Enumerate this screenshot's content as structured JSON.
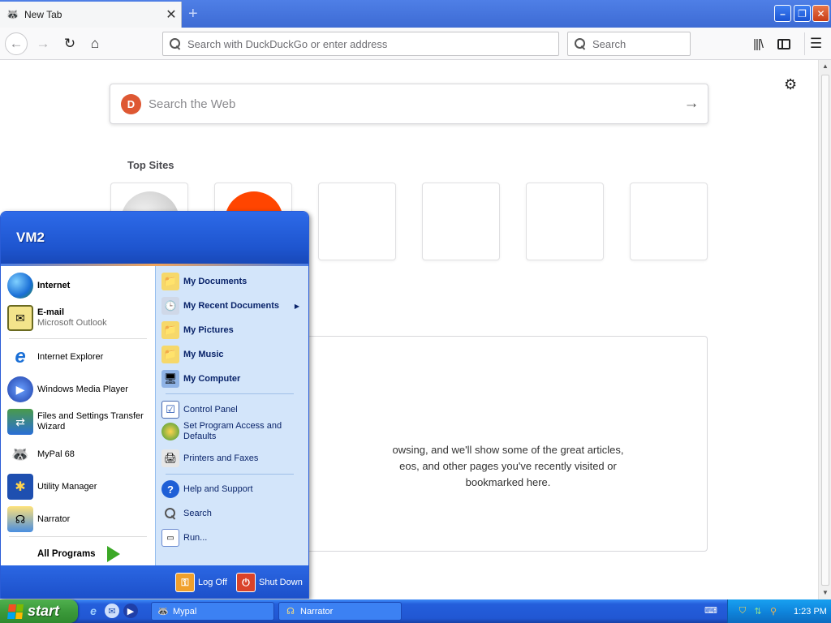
{
  "browser": {
    "tab_title": "New Tab",
    "tab_close": "✕",
    "new_tab": "+",
    "url_placeholder": "Search with DuckDuckGo or enter address",
    "search_placeholder": "Search"
  },
  "newtab": {
    "web_search_placeholder": "Search the Web",
    "top_sites_label": "Top Sites",
    "highlights_text_lines": [
      "owsing, and we'll show some of the great articles,",
      "eos, and other pages you've recently visited or",
      "bookmarked here."
    ]
  },
  "startmenu": {
    "user": "VM2",
    "pinned": [
      {
        "title": "Internet",
        "icon": "globe-icon"
      },
      {
        "title": "E-mail",
        "subtitle": "Microsoft Outlook",
        "icon": "outlook-icon"
      }
    ],
    "recent": [
      {
        "title": "Internet Explorer",
        "icon": "ie-icon"
      },
      {
        "title": "Windows Media Player",
        "icon": "media-player-icon"
      },
      {
        "title": "Files and Settings Transfer Wizard",
        "icon": "transfer-wizard-icon"
      },
      {
        "title": "MyPal 68",
        "icon": "mypal-icon"
      },
      {
        "title": "Utility Manager",
        "icon": "utility-manager-icon"
      },
      {
        "title": "Narrator",
        "icon": "narrator-icon"
      }
    ],
    "all_programs": "All Programs",
    "places": [
      {
        "title": "My Documents",
        "icon": "folder-icon"
      },
      {
        "title": "My Recent Documents",
        "icon": "recent-docs-icon"
      },
      {
        "title": "My Pictures",
        "icon": "folder-icon"
      },
      {
        "title": "My Music",
        "icon": "folder-icon"
      },
      {
        "title": "My Computer",
        "icon": "computer-icon"
      }
    ],
    "system": [
      {
        "title": "Control Panel",
        "icon": "control-panel-icon"
      },
      {
        "title": "Set Program Access and Defaults",
        "icon": "program-access-icon"
      },
      {
        "title": "Printers and Faxes",
        "icon": "printer-icon"
      }
    ],
    "help": [
      {
        "title": "Help and Support",
        "icon": "help-icon"
      },
      {
        "title": "Search",
        "icon": "search-icon"
      },
      {
        "title": "Run...",
        "icon": "run-icon"
      }
    ],
    "log_off": "Log Off",
    "shut_down": "Shut Down"
  },
  "taskbar": {
    "start_label": "start",
    "tasks": [
      {
        "title": "Mypal"
      },
      {
        "title": "Narrator"
      }
    ],
    "clock": "1:23 PM"
  }
}
